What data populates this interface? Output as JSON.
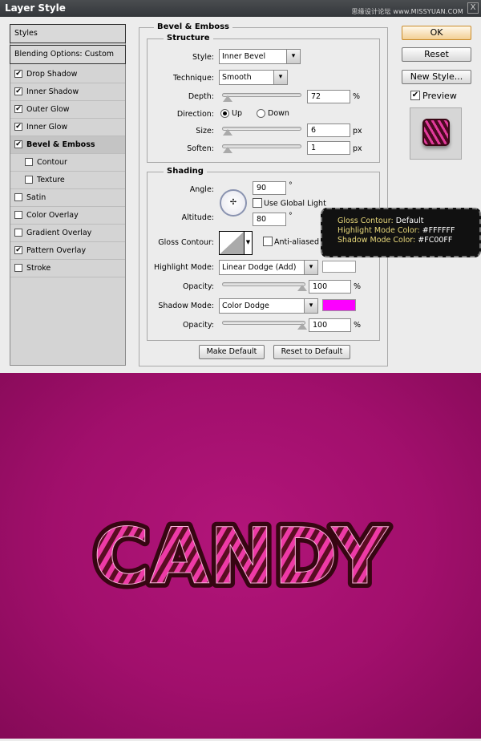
{
  "window": {
    "title": "Layer Style",
    "watermark": "思缘设计论坛 www.MISSYUAN.COM",
    "close": "X"
  },
  "sidebar": {
    "styles_label": "Styles",
    "blending_label": "Blending Options: Custom",
    "items": [
      {
        "label": "Drop Shadow",
        "checked": true
      },
      {
        "label": "Inner Shadow",
        "checked": true
      },
      {
        "label": "Outer Glow",
        "checked": true
      },
      {
        "label": "Inner Glow",
        "checked": true
      },
      {
        "label": "Bevel & Emboss",
        "checked": true,
        "selected": true
      },
      {
        "label": "Contour",
        "checked": false,
        "sub": true
      },
      {
        "label": "Texture",
        "checked": false,
        "sub": true
      },
      {
        "label": "Satin",
        "checked": false
      },
      {
        "label": "Color Overlay",
        "checked": false
      },
      {
        "label": "Gradient Overlay",
        "checked": false
      },
      {
        "label": "Pattern Overlay",
        "checked": true
      },
      {
        "label": "Stroke",
        "checked": false
      }
    ]
  },
  "bevel": {
    "title": "Bevel & Emboss",
    "structure": {
      "title": "Structure",
      "style_label": "Style:",
      "style_value": "Inner Bevel",
      "technique_label": "Technique:",
      "technique_value": "Smooth",
      "depth_label": "Depth:",
      "depth_value": "72",
      "depth_unit": "%",
      "direction_label": "Direction:",
      "dir_up": "Up",
      "dir_down": "Down",
      "direction_selected": "Up",
      "size_label": "Size:",
      "size_value": "6",
      "size_unit": "px",
      "soften_label": "Soften:",
      "soften_value": "1",
      "soften_unit": "px"
    },
    "shading": {
      "title": "Shading",
      "angle_label": "Angle:",
      "angle_value": "90",
      "deg": "°",
      "global_light_label": "Use Global Light",
      "global_light": false,
      "altitude_label": "Altitude:",
      "altitude_value": "80",
      "gloss_label": "Gloss Contour:",
      "antialiased_label": "Anti-aliased",
      "antialiased": false,
      "highlight_label": "Highlight Mode:",
      "highlight_value": "Linear Dodge (Add)",
      "highlight_color": "#FFFFFF",
      "hopacity_label": "Opacity:",
      "hopacity_value": "100",
      "pct": "%",
      "shadow_label": "Shadow Mode:",
      "shadow_value": "Color Dodge",
      "shadow_color": "#FC00FF",
      "sopacity_label": "Opacity:",
      "sopacity_value": "100"
    },
    "make_default": "Make Default",
    "reset_default": "Reset to Default"
  },
  "buttons": {
    "ok": "OK",
    "reset": "Reset",
    "new_style": "New Style...",
    "preview": "Preview",
    "preview_checked": true
  },
  "tooltip": {
    "k1": "Gloss Contour:",
    "v1": "Default",
    "k2": "Highlight Mode Color:",
    "v2": "#FFFFFF",
    "k3": "Shadow Mode Color:",
    "v3": "#FC00FF"
  },
  "artwork": {
    "text": "CANDY",
    "background": "#A30F6D"
  }
}
